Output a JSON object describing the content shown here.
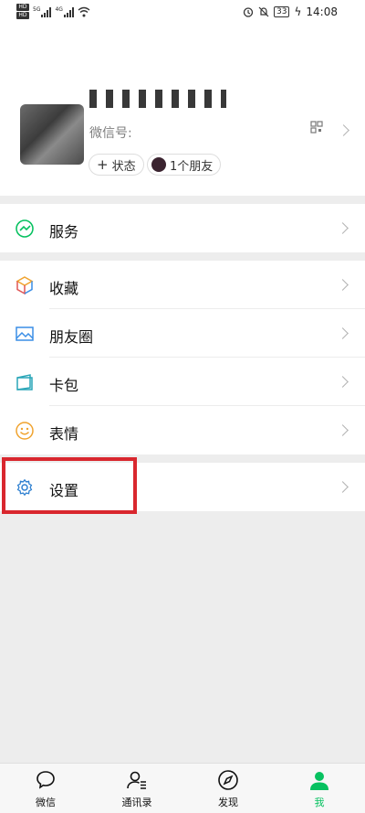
{
  "status_bar": {
    "time": "14:08",
    "battery": "33"
  },
  "profile": {
    "wechat_id_label": "微信号:",
    "status_label": "状态",
    "friends_label": "1个朋友"
  },
  "menu": {
    "services": "服务",
    "favorites": "收藏",
    "moments": "朋友圈",
    "cards": "卡包",
    "stickers": "表情",
    "settings": "设置"
  },
  "tabs": {
    "chats": "微信",
    "contacts": "通讯录",
    "discover": "发现",
    "me": "我"
  },
  "colors": {
    "accent": "#07c160",
    "highlight": "#d9272e"
  }
}
